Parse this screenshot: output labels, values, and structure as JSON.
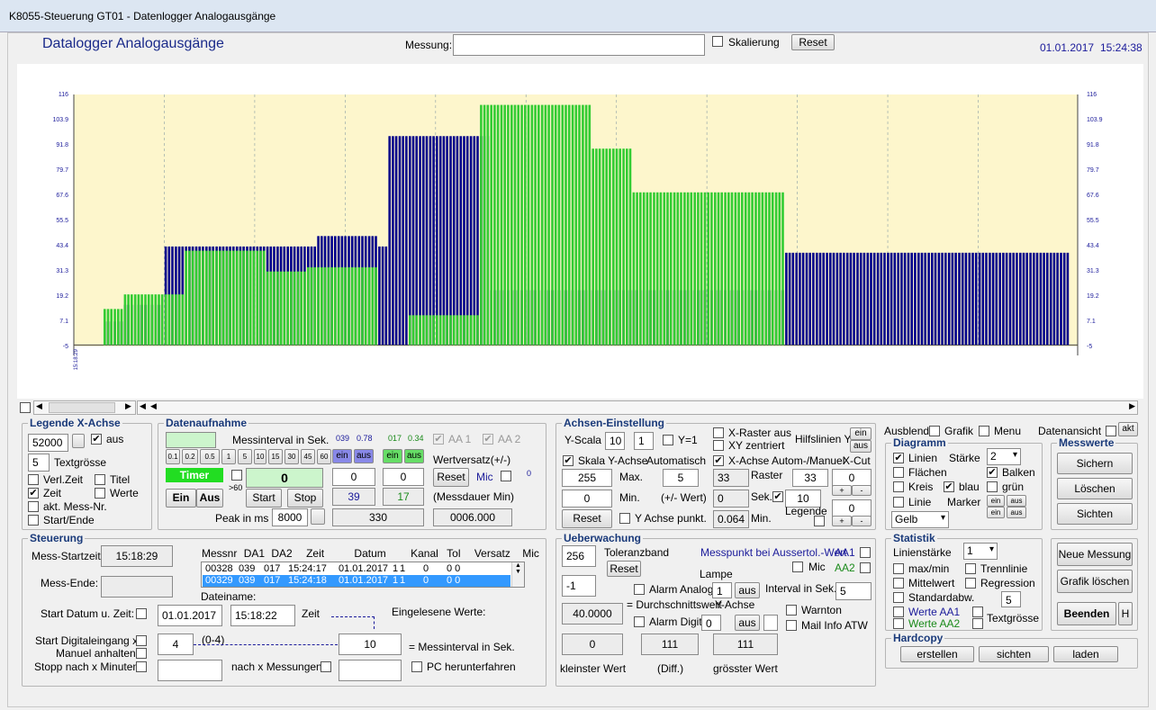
{
  "window": {
    "title": "K8055-Steuerung GT01 - Datenlogger Analogausgänge"
  },
  "header": {
    "app_title": "Datalogger Analogausgänge",
    "messung_label": "Messung:",
    "messung_value": "",
    "skalierung_label": "Skalierung",
    "reset_label": "Reset",
    "date": "01.01.2017",
    "time": "15:24:38"
  },
  "chart_data": {
    "type": "bar",
    "y_ticks": [
      "116",
      "103.9",
      "91.8",
      "79.7",
      "67.6",
      "55.5",
      "43.4",
      "31.3",
      "19.2",
      "7.1",
      "-5"
    ],
    "ylim": [
      -5,
      116
    ],
    "x_start_label": "15:18:29",
    "colors": {
      "blue": "#00008b",
      "green": "#33cc33",
      "background": "#fdf6cc"
    },
    "series": [
      {
        "name": "AA1",
        "color": "blue",
        "segments": [
          {
            "from": 0,
            "to": 2,
            "value": 7
          },
          {
            "from": 2,
            "to": 6,
            "value": 15
          },
          {
            "from": 6,
            "to": 21,
            "value": 43
          },
          {
            "from": 21,
            "to": 27,
            "value": 48
          },
          {
            "from": 27,
            "to": 28,
            "value": 43
          },
          {
            "from": 28,
            "to": 38,
            "value": 96
          },
          {
            "from": 38,
            "to": 67,
            "value": 22
          },
          {
            "from": 67,
            "to": 95,
            "value": 40
          }
        ]
      },
      {
        "name": "AA2",
        "color": "green",
        "segments": [
          {
            "from": 0,
            "to": 2,
            "value": 13
          },
          {
            "from": 2,
            "to": 8,
            "value": 20
          },
          {
            "from": 8,
            "to": 16,
            "value": 41
          },
          {
            "from": 16,
            "to": 20,
            "value": 31
          },
          {
            "from": 20,
            "to": 27,
            "value": 33
          },
          {
            "from": 27,
            "to": 30,
            "value": 0
          },
          {
            "from": 30,
            "to": 37,
            "value": 10
          },
          {
            "from": 37,
            "to": 48,
            "value": 111
          },
          {
            "from": 48,
            "to": 52,
            "value": 90
          },
          {
            "from": 52,
            "to": 67,
            "value": 69
          },
          {
            "from": 67,
            "to": 95,
            "value": 0
          }
        ]
      }
    ]
  },
  "legende": {
    "title": "Legende X-Achse",
    "value": "52000",
    "aus": "aus",
    "textsize": "5",
    "textsize_label": "Textgrösse",
    "items": [
      "Verl.Zeit",
      "Titel",
      "Zeit",
      "Werte",
      "akt. Mess-Nr.",
      "Start/Ende"
    ]
  },
  "datenaufnahme": {
    "title": "Datenaufnahme",
    "messinterval_label": "Messinterval in Sek.",
    "v039": "039",
    "v078": "0.78",
    "v017": "017",
    "v034": "0.34",
    "aa1": "AA 1",
    "aa2": "AA 2",
    "interval_buttons": [
      "0.1",
      "0.2",
      "0.5",
      "1",
      "5",
      "10",
      "15",
      "30",
      "45",
      "60"
    ],
    "ein": "ein",
    "aus": "aus",
    "timer": "Timer",
    "counter": "0",
    "gt60": ">60",
    "start": "Start",
    "stop": "Stop",
    "ein_btn": "Ein",
    "aus_btn": "Aus",
    "val1": "0",
    "val2": "0",
    "reset": "Reset",
    "wertversatz": "Wertversatz(+/-)",
    "mic": "Mic",
    "mic_val": "0",
    "val39": "39",
    "val17": "17",
    "messdauer": "(Messdauer Min)",
    "peak_label": "Peak in ms",
    "peak_value": "8000",
    "val330": "330",
    "dauer_value": "0006.000"
  },
  "achsen": {
    "title": "Achsen-Einstellung",
    "yscala_label": "Y-Scala",
    "yscala_v1": "10",
    "yscala_v2": "1",
    "y1": "Y=1",
    "skala_label": "Skala Y-Achse",
    "automatisch": "Automatisch",
    "max_value": "255",
    "max_label": "Max.",
    "auto_value": "5",
    "min_value": "0",
    "min_label": "Min.",
    "wert_label": "(+/- Wert)",
    "reset": "Reset",
    "ypunkt": "Y Achse punkt.",
    "xraster": "X-Raster aus",
    "xy_zentriert": "XY zentriert",
    "hilfslinien": "Hilfslinien Y",
    "ein": "ein",
    "aus": "aus",
    "xachse": "X-Achse Autom-/Manuel",
    "xcut": "X-Cut",
    "v33": "33",
    "raster": "Raster",
    "raster_v": "33",
    "xcut_v": "0",
    "v0": "0",
    "sek": "Sek.",
    "sek_v": "10",
    "legende": "Legende",
    "leg_v": "0",
    "v0064": "0.064",
    "min": "Min."
  },
  "right": {
    "ausblend": "Ausblend.",
    "grafik": "Grafik",
    "menu": "Menu",
    "datenansicht": "Datenansicht",
    "akt": "akt",
    "diagramm_title": "Diagramm",
    "linien": "Linien",
    "staerke_label": "Stärke",
    "staerke_value": "2",
    "flaechen": "Flächen",
    "balken": "Balken",
    "kreis": "Kreis",
    "blau": "blau",
    "gruen": "grün",
    "linie": "Linie",
    "marker": "Marker",
    "ein": "ein",
    "aus": "aus",
    "color_select": "Gelb",
    "messwerte_title": "Messwerte",
    "sichern": "Sichern",
    "loeschen": "Löschen",
    "sichten": "Sichten",
    "statistik_title": "Statistik",
    "linienstaerke": "Linienstärke",
    "linienstaerke_v": "1",
    "maxmin": "max/min",
    "trennlinie": "Trennlinie",
    "mittelwert": "Mittelwert",
    "regression": "Regression",
    "standardabw": "Standardabw.",
    "werte_aa1": "Werte AA1",
    "werte_aa2": "Werte AA2",
    "textgroesse": "Textgrösse",
    "textgroesse_v": "5",
    "neue_messung": "Neue Messung",
    "grafik_loeschen": "Grafik löschen",
    "beenden": "Beenden",
    "h": "H",
    "hardcopy_title": "Hardcopy",
    "erstellen": "erstellen",
    "sichten2": "sichten",
    "laden": "laden"
  },
  "steuerung": {
    "title": "Steuerung",
    "start_label": "Mess-Startzeit:",
    "start_value": "15:18:29",
    "ende_label": "Mess-Ende:",
    "ende_value": "",
    "list_headers": [
      "Messnr",
      "DA1",
      "DA2",
      "Zeit",
      "Datum",
      "Kanal",
      "Tol",
      "Versatz",
      "Mic"
    ],
    "rows": [
      [
        "00328",
        "039",
        "017",
        "15:24:17",
        "01.01.2017",
        "1",
        "1",
        "0",
        "0 0",
        "0"
      ],
      [
        "00329",
        "039",
        "017",
        "15:24:18",
        "01.01.2017",
        "1",
        "1",
        "0",
        "0 0",
        "0"
      ]
    ],
    "dateiname": "Dateiname:",
    "start_datum_label": "Start Datum u. Zeit:",
    "datum": "01.01.2017",
    "zeit": "15:18:22",
    "zeit_label": "Zeit",
    "eingelesen": "Eingelesene Werte:",
    "digital_label": "Start Digitaleingang x:",
    "manuel_label": "Manuel anhalten",
    "stopp_label": "Stopp nach x Minuten:",
    "digital_v": "4",
    "range": "(0-4)",
    "interval_v": "10",
    "interval_label": "= Messinterval in Sek.",
    "nach_label": "nach x Messungen",
    "pc_label": "PC herunterfahren"
  },
  "ueberwachung": {
    "title": "Ueberwachung",
    "tol_v": "256",
    "toleranzband": "Toleranzband",
    "reset": "Reset",
    "messpunkt": "Messpunkt bei Aussertol.-Wert",
    "aa1": "AA1",
    "mic": "Mic",
    "aa2": "AA2",
    "lampe": "Lampe",
    "v_neg1": "-1",
    "alarm_analog": "Alarm Analog",
    "v1": "1",
    "aus": "aus",
    "interval_label": "Interval in Sek.",
    "interval_v": "5",
    "durchschnitt": "= Durchschnittswert",
    "yachse": "Y-Achse",
    "avg_v": "40.0000",
    "alarm_digit": "Alarm Digit:",
    "v0": "0",
    "warnton": "Warnton",
    "mailinfo": "Mail Info ATW",
    "kleinster": "0",
    "diff": "111",
    "groesster": "111",
    "kleinster_label": "kleinster Wert",
    "diff_label": "(Diff.)",
    "groesster_label": "grösster Wert"
  }
}
